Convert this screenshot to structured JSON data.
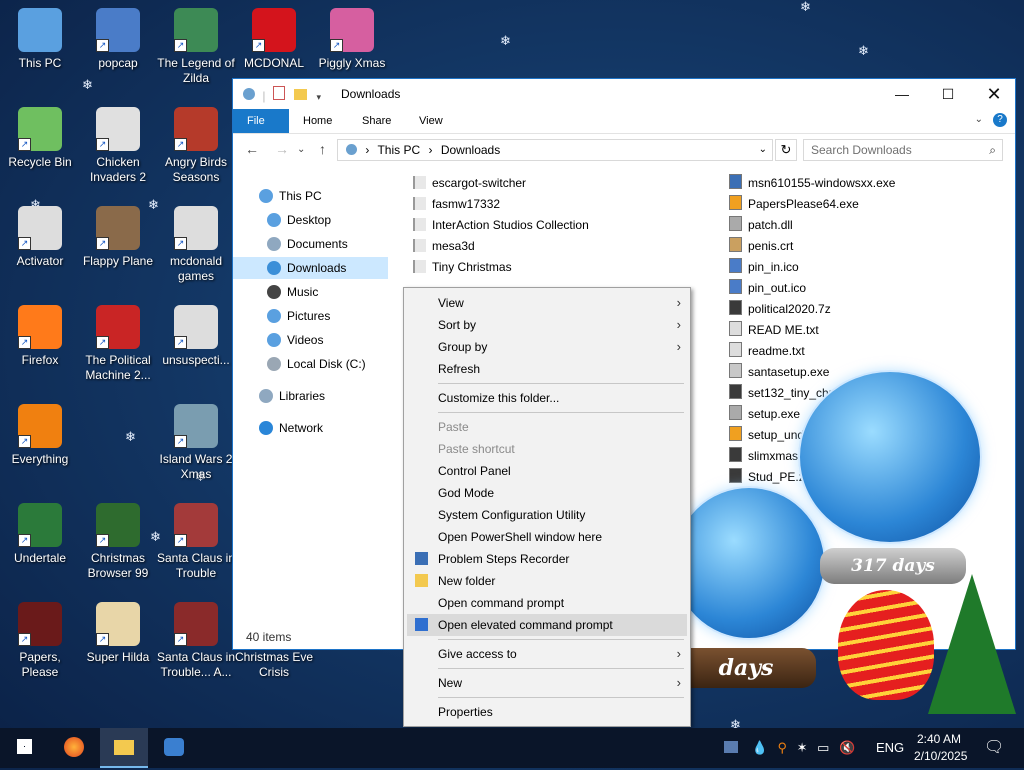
{
  "desktop_icons": [
    {
      "label": "This PC",
      "color": "#5aa0e0"
    },
    {
      "label": "popcap",
      "color": "#4a7cc8"
    },
    {
      "label": "The Legend of Zilda",
      "color": "#3d8a55"
    },
    {
      "label": "MCDONAL",
      "color": "#d4141c"
    },
    {
      "label": "Piggly Xmas",
      "color": "#d65fa0"
    },
    {
      "label": "Recycle Bin",
      "color": "#6fbf60"
    },
    {
      "label": "Chicken Invaders 2",
      "color": "#e0e0e0"
    },
    {
      "label": "Angry Birds Seasons",
      "color": "#b53a2a"
    },
    {
      "label": "Activator",
      "color": "#dddddd"
    },
    {
      "label": "Flappy Plane",
      "color": "#8a6a4a"
    },
    {
      "label": "mcdonald games",
      "color": "#dddddd"
    },
    {
      "label": "Firefox",
      "color": "#ff7a1a"
    },
    {
      "label": "The Political Machine 2...",
      "color": "#c92525"
    },
    {
      "label": "unsuspecti...",
      "color": "#dddddd"
    },
    {
      "label": "Everything",
      "color": "#f08010"
    },
    {
      "label": "Island Wars 2 Xmas",
      "color": "#7a9db0"
    },
    {
      "label": "Undertale",
      "color": "#2b7a3a"
    },
    {
      "label": "Christmas Browser 99",
      "color": "#2e6b2e"
    },
    {
      "label": "Santa Claus in Trouble",
      "color": "#a33a3a"
    },
    {
      "label": "Papers, Please",
      "color": "#6a1a1a"
    },
    {
      "label": "Super Hilda",
      "color": "#e8d6a8"
    },
    {
      "label": "Santa Claus in Trouble... A...",
      "color": "#8a2a2a"
    },
    {
      "label": "Christmas Eve Crisis",
      "color": "#0b2146"
    }
  ],
  "window": {
    "title": "Downloads",
    "ribbon_tabs": [
      "File",
      "Home",
      "Share",
      "View"
    ],
    "address": {
      "root": "This PC",
      "current": "Downloads"
    },
    "search_placeholder": "Search Downloads",
    "nav": [
      {
        "label": "This PC",
        "color": "#5aa0e0"
      },
      {
        "label": "Desktop",
        "color": "#5aa0e0"
      },
      {
        "label": "Documents",
        "color": "#8fa8c0"
      },
      {
        "label": "Downloads",
        "color": "#3b8fd8",
        "selected": true
      },
      {
        "label": "Music",
        "color": "#444444"
      },
      {
        "label": "Pictures",
        "color": "#5aa0e0"
      },
      {
        "label": "Videos",
        "color": "#5aa0e0"
      },
      {
        "label": "Local Disk (C:)",
        "color": "#9aa7b4"
      },
      {
        "label": "Libraries",
        "color": "#8fa8c0"
      },
      {
        "label": "Network",
        "color": "#2a86d8"
      }
    ],
    "files_left": [
      "escargot-switcher",
      "fasmw17332",
      "InterAction Studios Collection",
      "mesa3d",
      "Tiny Christmas"
    ],
    "files_right": [
      "msn610155-windowsxx.exe",
      "PapersPlease64.exe",
      "patch.dll",
      "penis.crt",
      "pin_in.ico",
      "pin_out.ico",
      "political2020.7z",
      "READ ME.txt",
      "readme.txt",
      "santasetup.exe",
      "set132_tiny_chri",
      "setup.exe",
      "setup_und",
      "slimxmas.",
      "Stud_PE.zi"
    ],
    "status": "40 items"
  },
  "context_menu": [
    {
      "label": "View",
      "submenu": true
    },
    {
      "label": "Sort by",
      "submenu": true
    },
    {
      "label": "Group by",
      "submenu": true
    },
    {
      "label": "Refresh"
    },
    {
      "label": "Customize this folder..."
    },
    {
      "label": "Paste",
      "disabled": true
    },
    {
      "label": "Paste shortcut",
      "disabled": true
    },
    {
      "label": "Control Panel"
    },
    {
      "label": "God Mode"
    },
    {
      "label": "System Configuration Utility"
    },
    {
      "label": "Open PowerShell window here"
    },
    {
      "label": "Problem Steps Recorder",
      "icon": "steps-recorder-icon"
    },
    {
      "label": "New folder",
      "icon": "folder-icon"
    },
    {
      "label": "Open command prompt"
    },
    {
      "label": "Open elevated command prompt",
      "icon": "shield-icon",
      "highlighted": true
    },
    {
      "label": "Give access to",
      "submenu": true
    },
    {
      "label": "New",
      "submenu": true
    },
    {
      "label": "Properties"
    }
  ],
  "gadgets": {
    "globe1": "317 days",
    "globe2": "days"
  },
  "taskbar": {
    "lang": "ENG",
    "time": "2:40 AM",
    "date": "2/10/2025"
  }
}
